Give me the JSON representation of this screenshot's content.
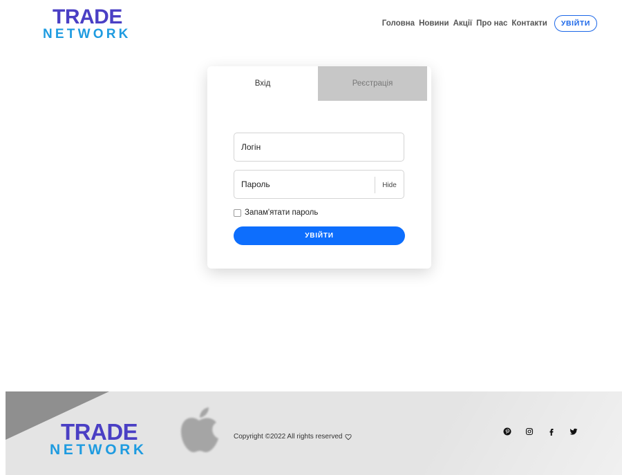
{
  "brand": {
    "line1": "TRADE",
    "line2": "NETWORK"
  },
  "nav": {
    "items": [
      "Головна",
      "Новини",
      "Акції",
      "Про нас",
      "Контакти"
    ],
    "login": "УВІЙТИ"
  },
  "auth": {
    "tabs": {
      "login": "Вхід",
      "register": "Реєстрація"
    },
    "login_placeholder": "Логін",
    "password_placeholder": "Пароль",
    "hide_label": "Hide",
    "remember_label": "Запам'ятати пароль",
    "submit_label": "УВІЙТИ"
  },
  "footer": {
    "copyright": "Copyright ©2022 All rights reserved",
    "socials": [
      "pinterest-icon",
      "instagram-icon",
      "facebook-icon",
      "twitter-icon"
    ]
  },
  "colors": {
    "primary": "#0d6efd",
    "brand_purple": "#4a3fc4",
    "brand_blue": "#1e9be0"
  }
}
